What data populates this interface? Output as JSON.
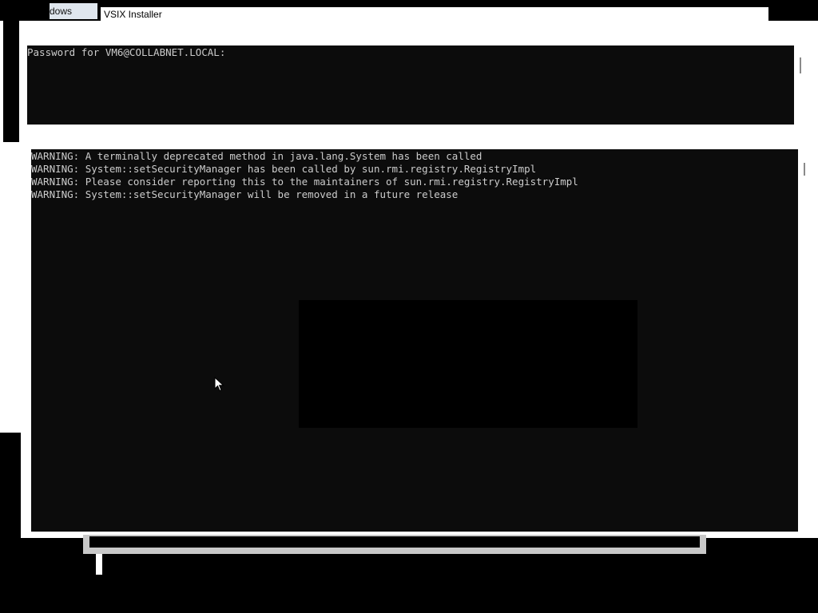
{
  "background_window": {
    "tab_label": "dows"
  },
  "dialog": {
    "title": "VSIX Installer",
    "close_glyph": "×"
  },
  "password_console": {
    "prompt": "Password for VM6@COLLABNET.LOCAL:"
  },
  "output_console": {
    "lines": [
      "WARNING: A terminally deprecated method in java.lang.System has been called",
      "WARNING: System::setSecurityManager has been called by sun.rmi.registry.RegistryImpl",
      "WARNING: Please consider reporting this to the maintainers of sun.rmi.registry.RegistryImpl",
      "WARNING: System::setSecurityManager will be removed in a future release"
    ]
  },
  "colors": {
    "console_bg": "#0c0c0c",
    "console_text": "#cccccc",
    "window_bg": "#ffffff"
  }
}
